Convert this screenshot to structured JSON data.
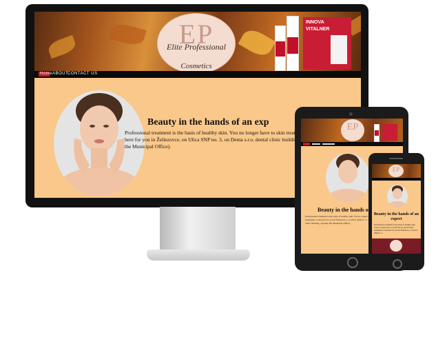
{
  "brand": {
    "logo_letters": "EP",
    "logo_line1": "Elite Professional",
    "logo_line2": "Cosmetics"
  },
  "nav": {
    "items": [
      "Home",
      "ABOUT",
      "CONTACT US"
    ]
  },
  "main": {
    "title": "Beauty in the hands of an exp",
    "paragraph": "Professional treatment is the basis of healthy skin. You no longer have to skin treatments. I am here for you in Želiezovce, on Ulica SNP no. 3, on Denta s.r.o. dental clinic building, opposite the Municipal Office)."
  },
  "product": {
    "box_label": "VITALNER",
    "box_brand": "INNOVA"
  },
  "tablet": {
    "title": "Beauty in the hands of an",
    "paragraph": "Professional treatment is the basis of healthy skin. You no longer have to special skin treatments. I am here for you in Želiezovce, on Ulica SNP no. 3, on the Denta s.r.o. dental clinic building, opposite the Municipal Office)."
  },
  "phone": {
    "title": "Beauty in the hands of an expert",
    "paragraph": "Professional treatment is the basis of healthy skin. You no longer have to travel far for special skin treatments. I am here for you in Želiezovce, on Ulica SNP no. 3."
  },
  "colors": {
    "page_bg": "#fac88a",
    "nav_bg": "#0a0a0a",
    "accent": "#c31b2b",
    "footer": "#7a1c26"
  }
}
